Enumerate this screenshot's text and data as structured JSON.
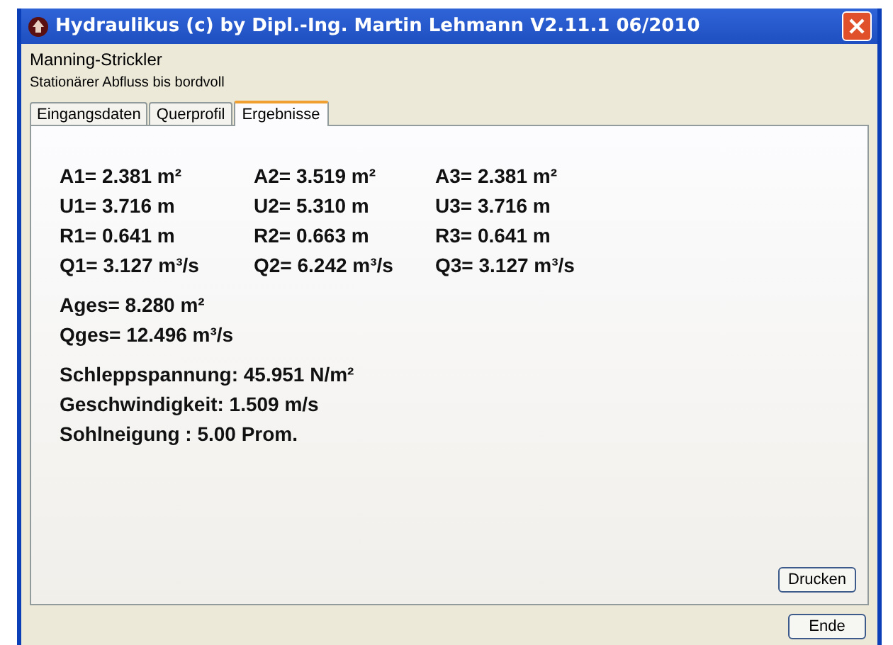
{
  "window": {
    "title": "Hydraulikus (c) by Dipl.-Ing. Martin Lehmann V2.11.1 06/2010"
  },
  "heading": "Manning-Strickler",
  "subheading": "Stationärer Abfluss bis bordvoll",
  "tabs": [
    {
      "label": "Eingangsdaten",
      "selected": false
    },
    {
      "label": "Querprofil",
      "selected": false
    },
    {
      "label": "Ergebnisse",
      "selected": true
    }
  ],
  "results": {
    "rows": [
      [
        "A1= 2.381 m²",
        "A2= 3.519 m²",
        "A3= 2.381 m²"
      ],
      [
        "U1= 3.716 m",
        "U2= 5.310 m",
        "U3= 3.716 m"
      ],
      [
        "R1= 0.641 m",
        "R2= 0.663 m",
        "R3= 0.641 m"
      ],
      [
        "Q1= 3.127 m³/s",
        "Q2= 6.242 m³/s",
        "Q3= 3.127 m³/s"
      ]
    ],
    "totals": [
      "Ages= 8.280 m²",
      "Qges= 12.496 m³/s"
    ],
    "summary": [
      "Schleppspannung: 45.951 N/m²",
      "Geschwindigkeit: 1.509 m/s",
      "Sohlneigung : 5.00 Prom."
    ]
  },
  "print_button": "Drucken",
  "end_button": "Ende"
}
